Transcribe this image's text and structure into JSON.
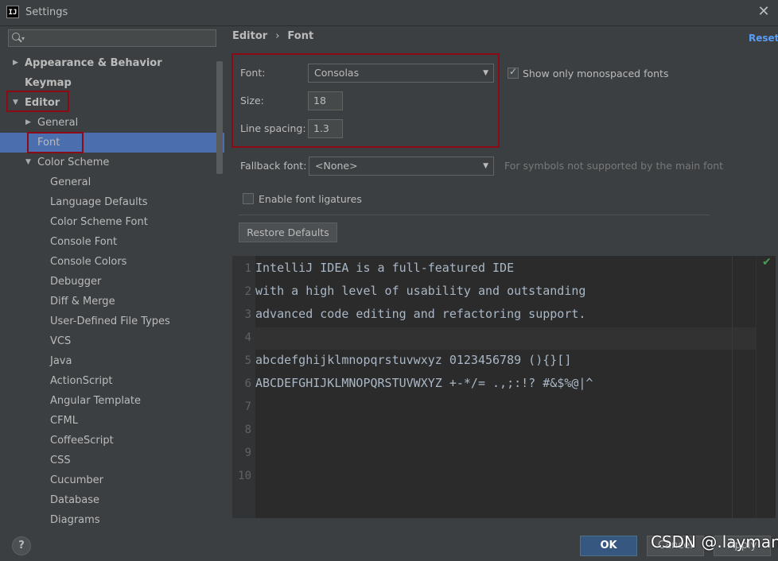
{
  "window": {
    "title": "Settings",
    "app_icon": "IJ"
  },
  "search": {
    "placeholder": ""
  },
  "sidebar": {
    "items": [
      {
        "label": "Appearance & Behavior",
        "level": 0,
        "arrow": "▶",
        "bold": true
      },
      {
        "label": "Keymap",
        "level": 0,
        "arrow": "",
        "bold": true
      },
      {
        "label": "Editor",
        "level": 0,
        "arrow": "▼",
        "bold": true
      },
      {
        "label": "General",
        "level": 1,
        "arrow": "▶"
      },
      {
        "label": "Font",
        "level": 1,
        "arrow": "",
        "selected": true
      },
      {
        "label": "Color Scheme",
        "level": 1,
        "arrow": "▼"
      },
      {
        "label": "General",
        "level": 2
      },
      {
        "label": "Language Defaults",
        "level": 2
      },
      {
        "label": "Color Scheme Font",
        "level": 2
      },
      {
        "label": "Console Font",
        "level": 2
      },
      {
        "label": "Console Colors",
        "level": 2
      },
      {
        "label": "Debugger",
        "level": 2
      },
      {
        "label": "Diff & Merge",
        "level": 2
      },
      {
        "label": "User-Defined File Types",
        "level": 2
      },
      {
        "label": "VCS",
        "level": 2
      },
      {
        "label": "Java",
        "level": 2
      },
      {
        "label": "ActionScript",
        "level": 2
      },
      {
        "label": "Angular Template",
        "level": 2
      },
      {
        "label": "CFML",
        "level": 2
      },
      {
        "label": "CoffeeScript",
        "level": 2
      },
      {
        "label": "CSS",
        "level": 2
      },
      {
        "label": "Cucumber",
        "level": 2
      },
      {
        "label": "Database",
        "level": 2
      },
      {
        "label": "Diagrams",
        "level": 2
      }
    ]
  },
  "breadcrumb": {
    "parent": "Editor",
    "separator": "›",
    "current": "Font"
  },
  "reset_label": "Reset",
  "font_settings": {
    "font_label": "Font:",
    "font_value": "Consolas",
    "monospaced_label": "Show only monospaced fonts",
    "monospaced_checked": true,
    "size_label": "Size:",
    "size_value": "18",
    "line_spacing_label": "Line spacing:",
    "line_spacing_value": "1.3",
    "fallback_label": "Fallback font:",
    "fallback_value": "<None>",
    "fallback_hint": "For symbols not supported by the main font",
    "ligatures_label": "Enable font ligatures",
    "ligatures_checked": false,
    "restore_label": "Restore Defaults"
  },
  "preview": {
    "lines": [
      {
        "num": "1",
        "text": "IntelliJ IDEA is a full-featured IDE"
      },
      {
        "num": "2",
        "text": "with a high level of usability and outstanding"
      },
      {
        "num": "3",
        "text": "advanced code editing and refactoring support."
      },
      {
        "num": "4",
        "text": ""
      },
      {
        "num": "5",
        "text": "abcdefghijklmnopqrstuvwxyz 0123456789 (){}[]"
      },
      {
        "num": "6",
        "text": "ABCDEFGHIJKLMNOPQRSTUVWXYZ +-*/= .,;:!? #&$%@|^"
      },
      {
        "num": "7",
        "text": ""
      },
      {
        "num": "8",
        "text": ""
      },
      {
        "num": "9",
        "text": ""
      },
      {
        "num": "10",
        "text": ""
      }
    ]
  },
  "buttons": {
    "help": "?",
    "ok": "OK",
    "cancel": "Cancel",
    "apply": "Apply"
  },
  "watermark": "CSDN @.layman",
  "colors": {
    "background": "#3c3f41",
    "selection": "#4b6eaf",
    "accent_link": "#589df6",
    "highlight_box": "#8b0a14",
    "editor_bg": "#2b2b2b"
  }
}
